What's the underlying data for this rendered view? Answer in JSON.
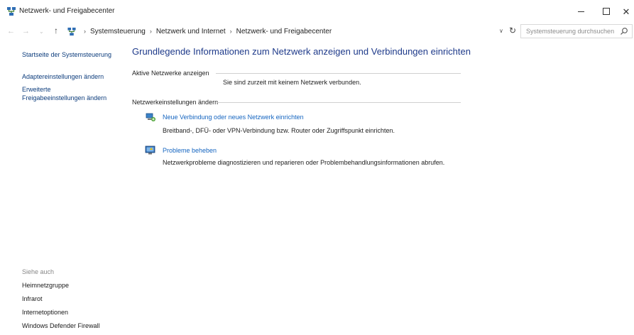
{
  "window": {
    "title": "Netzwerk- und Freigabecenter"
  },
  "address": {
    "crumbs": [
      "Systemsteuerung",
      "Netzwerk und Internet",
      "Netzwerk- und Freigabecenter"
    ],
    "search_placeholder": "Systemsteuerung durchsuchen"
  },
  "sidebar": {
    "home": "Startseite der Systemsteuerung",
    "adapter": "Adaptereinstellungen ändern",
    "sharing_line1": "Erweiterte",
    "sharing_line2": "Freigabeeinstellungen ändern",
    "see_also": "Siehe auch",
    "links": [
      "Heimnetzgruppe",
      "Infrarot",
      "Internetoptionen",
      "Windows Defender Firewall"
    ]
  },
  "main": {
    "title": "Grundlegende Informationen zum Netzwerk anzeigen und Verbindungen einrichten",
    "active_label": "Aktive Netzwerke anzeigen",
    "no_network": "Sie sind zurzeit mit keinem Netzwerk verbunden.",
    "settings_label": "Netzwerkeinstellungen ändern",
    "tasks": [
      {
        "link": "Neue Verbindung oder neues Netzwerk einrichten",
        "desc": "Breitband-, DFÜ- oder VPN-Verbindung bzw. Router oder Zugriffspunkt einrichten."
      },
      {
        "link": "Probleme beheben",
        "desc": "Netzwerkprobleme diagnostizieren und reparieren oder Problembehandlungsinformationen abrufen."
      }
    ]
  },
  "colors": {
    "link": "#1565c0",
    "heading": "#1e3a8a",
    "sidebar_link": "#0c3c7c"
  }
}
